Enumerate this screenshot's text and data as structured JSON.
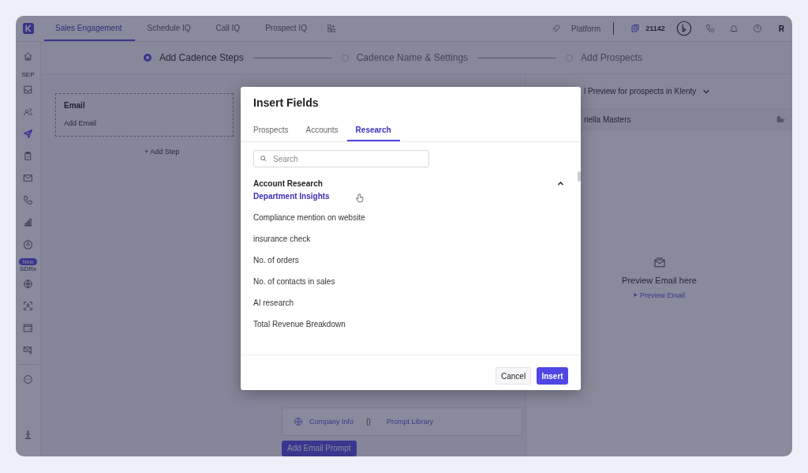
{
  "topbar": {
    "tabs": [
      {
        "label": "Sales Engagement",
        "selected": true
      },
      {
        "label": "Schedule IQ",
        "selected": false
      },
      {
        "label": "Call IQ",
        "selected": false
      },
      {
        "label": "Prospect IQ",
        "selected": false
      }
    ],
    "platform": "Platform",
    "credits": "21142",
    "user_initial": "R"
  },
  "sidebar": {
    "top": [
      {
        "kind": "icon",
        "selected": false
      },
      {
        "kind": "label",
        "text": "SEP"
      },
      {
        "kind": "icon",
        "selected": false
      },
      {
        "kind": "icon",
        "selected": false
      },
      {
        "kind": "icon",
        "selected": true
      },
      {
        "kind": "icon",
        "selected": false
      },
      {
        "kind": "icon",
        "selected": false
      },
      {
        "kind": "icon",
        "selected": false
      },
      {
        "kind": "icon",
        "selected": false
      },
      {
        "kind": "icon",
        "selected": false
      },
      {
        "kind": "badge",
        "text": "New"
      },
      {
        "kind": "label",
        "text": "SDRx"
      },
      {
        "kind": "icon",
        "selected": false
      },
      {
        "kind": "icon",
        "selected": false
      },
      {
        "kind": "icon",
        "selected": false
      },
      {
        "kind": "icon",
        "selected": false
      },
      {
        "kind": "divider"
      },
      {
        "kind": "icon",
        "selected": false
      }
    ],
    "bottom": [
      {
        "kind": "icon",
        "selected": false
      }
    ]
  },
  "stepper": {
    "steps": [
      {
        "label": "Add Cadence Steps",
        "selected": true
      },
      {
        "label": "Cadence Name & Settings",
        "selected": false
      },
      {
        "label": "Add Prospects",
        "selected": false
      }
    ]
  },
  "steps_panel": {
    "card": {
      "title": "Email",
      "subtitle": "Add Email"
    },
    "add_step": "+ Add Step"
  },
  "editor": {
    "company_info": "Company Info",
    "braces": "{}",
    "prompt_library": "Prompt Library",
    "add_button": "Add Email Prompt"
  },
  "preview": {
    "header": "l Preview for prospects in Klenty",
    "prospect": "riella Masters",
    "empty_title": "Preview Email here",
    "preview_link": "Preview Email"
  },
  "modal": {
    "title": "Insert Fields",
    "tabs": [
      {
        "label": "Prospects",
        "selected": false
      },
      {
        "label": "Accounts",
        "selected": false
      },
      {
        "label": "Research",
        "selected": true
      }
    ],
    "search": {
      "placeholder": "Search"
    },
    "section": {
      "title": "Account Research",
      "expanded": true,
      "items": [
        {
          "label": "Department Insights",
          "highlighted": true
        },
        {
          "label": "Compliance mention on website",
          "highlighted": false
        },
        {
          "label": "insurance check",
          "highlighted": false
        },
        {
          "label": "No. of orders",
          "highlighted": false
        },
        {
          "label": "No. of contacts in sales",
          "highlighted": false
        },
        {
          "label": "AI research",
          "highlighted": false
        },
        {
          "label": "Total Revenue Breakdown",
          "highlighted": false
        }
      ]
    },
    "buttons": {
      "cancel": "Cancel",
      "insert": "Insert"
    }
  }
}
